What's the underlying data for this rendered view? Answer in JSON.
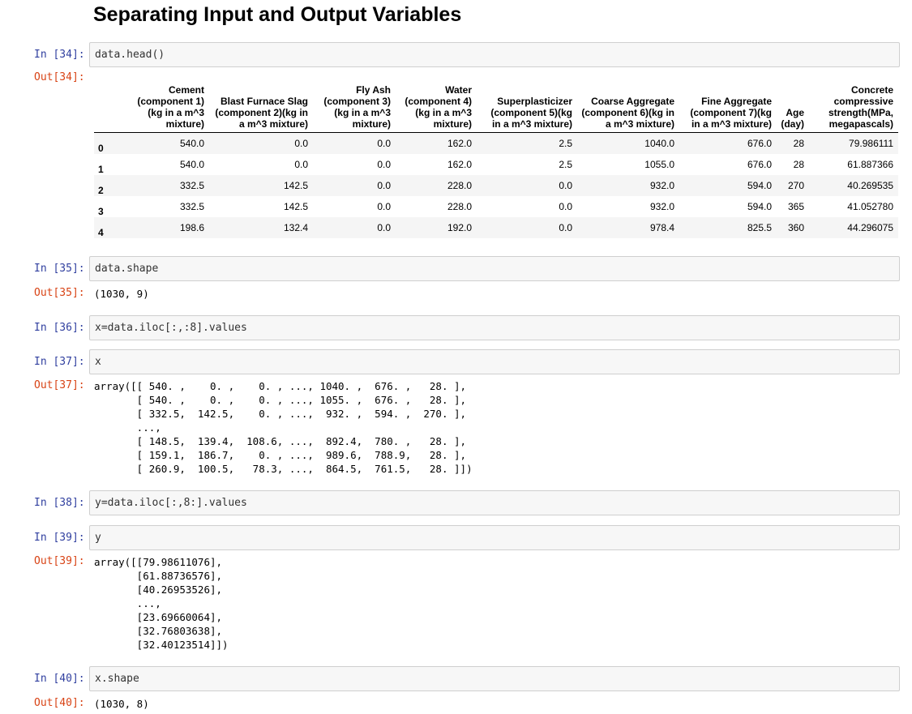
{
  "heading": "Separating Input and Output Variables",
  "cells": {
    "c34": {
      "in_prompt": "In [34]:",
      "code": "data.head()",
      "out_prompt": "Out[34]:"
    },
    "c35": {
      "in_prompt": "In [35]:",
      "code": "data.shape",
      "out_prompt": "Out[35]:",
      "output": "(1030, 9)"
    },
    "c36": {
      "in_prompt": "In [36]:",
      "code": "x=data.iloc[:,:8].values"
    },
    "c37": {
      "in_prompt": "In [37]:",
      "code": "x",
      "out_prompt": "Out[37]:",
      "output": "array([[ 540. ,    0. ,    0. , ..., 1040. ,  676. ,   28. ],\n       [ 540. ,    0. ,    0. , ..., 1055. ,  676. ,   28. ],\n       [ 332.5,  142.5,    0. , ...,  932. ,  594. ,  270. ],\n       ...,\n       [ 148.5,  139.4,  108.6, ...,  892.4,  780. ,   28. ],\n       [ 159.1,  186.7,    0. , ...,  989.6,  788.9,   28. ],\n       [ 260.9,  100.5,   78.3, ...,  864.5,  761.5,   28. ]])"
    },
    "c38": {
      "in_prompt": "In [38]:",
      "code": "y=data.iloc[:,8:].values"
    },
    "c39": {
      "in_prompt": "In [39]:",
      "code": "y",
      "out_prompt": "Out[39]:",
      "output": "array([[79.98611076],\n       [61.88736576],\n       [40.26953526],\n       ...,\n       [23.69660064],\n       [32.76803638],\n       [32.40123514]])"
    },
    "c40": {
      "in_prompt": "In [40]:",
      "code": "x.shape",
      "out_prompt": "Out[40]:",
      "output": "(1030, 8)"
    }
  },
  "table": {
    "columns": [
      "Cement\n(component 1)\n(kg in a m^3\nmixture)",
      "Blast Furnace Slag\n(component 2)(kg in\na m^3 mixture)",
      "Fly Ash\n(component 3)\n(kg in a m^3\nmixture)",
      "Water\n(component 4)\n(kg in a m^3\nmixture)",
      "Superplasticizer\n(component 5)(kg\nin a m^3 mixture)",
      "Coarse Aggregate\n(component 6)(kg in\na m^3 mixture)",
      "Fine Aggregate\n(component 7)(kg\nin a m^3 mixture)",
      "Age\n(day)",
      "Concrete\ncompressive\nstrength(MPa,\nmegapascals)"
    ],
    "rows": [
      {
        "index": "0",
        "values": [
          "540.0",
          "0.0",
          "0.0",
          "162.0",
          "2.5",
          "1040.0",
          "676.0",
          "28",
          "79.986111"
        ]
      },
      {
        "index": "1",
        "values": [
          "540.0",
          "0.0",
          "0.0",
          "162.0",
          "2.5",
          "1055.0",
          "676.0",
          "28",
          "61.887366"
        ]
      },
      {
        "index": "2",
        "values": [
          "332.5",
          "142.5",
          "0.0",
          "228.0",
          "0.0",
          "932.0",
          "594.0",
          "270",
          "40.269535"
        ]
      },
      {
        "index": "3",
        "values": [
          "332.5",
          "142.5",
          "0.0",
          "228.0",
          "0.0",
          "932.0",
          "594.0",
          "365",
          "41.052780"
        ]
      },
      {
        "index": "4",
        "values": [
          "198.6",
          "132.4",
          "0.0",
          "192.0",
          "0.0",
          "978.4",
          "825.5",
          "360",
          "44.296075"
        ]
      }
    ]
  },
  "colors": {
    "in_prompt": "#303f9f",
    "out_prompt": "#d84315",
    "cell_bg": "#f7f7f7",
    "cell_border": "#cfcfcf"
  }
}
